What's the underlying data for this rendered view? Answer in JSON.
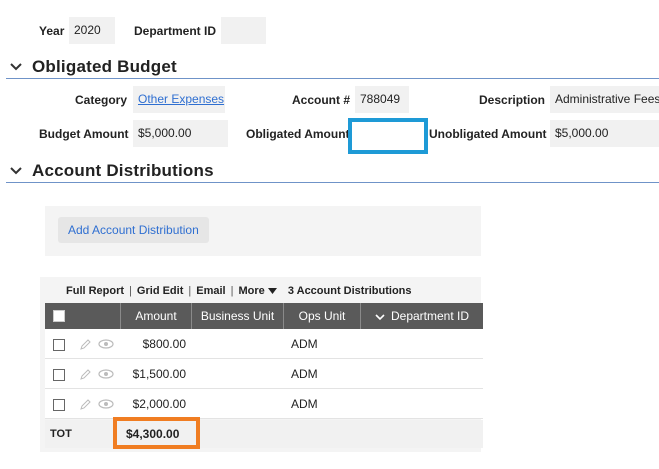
{
  "header": {
    "year_label": "Year",
    "year_value": "2020",
    "department_label": "Department ID",
    "department_value": ""
  },
  "obligated_budget": {
    "title": "Obligated Budget",
    "category_label": "Category",
    "category_value": "Other Expenses",
    "account_label": "Account #",
    "account_value": "788049",
    "description_label": "Description",
    "description_value": "Administrative Fees",
    "budget_amount_label": "Budget Amount",
    "budget_amount_value": "$5,000.00",
    "obligated_amount_label": "Obligated Amount",
    "obligated_amount_value": "",
    "unobligated_amount_label": "Unobligated Amount",
    "unobligated_amount_value": "$5,000.00"
  },
  "account_distributions": {
    "title": "Account Distributions",
    "add_button_label": "Add  Account Distribution",
    "toolbar": {
      "full_report": "Full Report",
      "grid_edit": "Grid Edit",
      "email": "Email",
      "more": "More",
      "count_label": "3 Account Distributions"
    },
    "columns": [
      "Amount",
      "Business Unit",
      "Ops Unit",
      "Department ID"
    ],
    "rows": [
      {
        "amount": "$800.00",
        "business_unit": "",
        "ops_unit": "ADM",
        "department_id": ""
      },
      {
        "amount": "$1,500.00",
        "business_unit": "",
        "ops_unit": "ADM",
        "department_id": ""
      },
      {
        "amount": "$2,000.00",
        "business_unit": "",
        "ops_unit": "ADM",
        "department_id": ""
      }
    ],
    "total_label": "TOT",
    "total_amount": "$4,300.00"
  },
  "colors": {
    "highlight_blue": "#1e9ad6",
    "highlight_orange": "#f07d22",
    "link": "#2f6fd1",
    "grid_header": "#5a5a5a"
  }
}
